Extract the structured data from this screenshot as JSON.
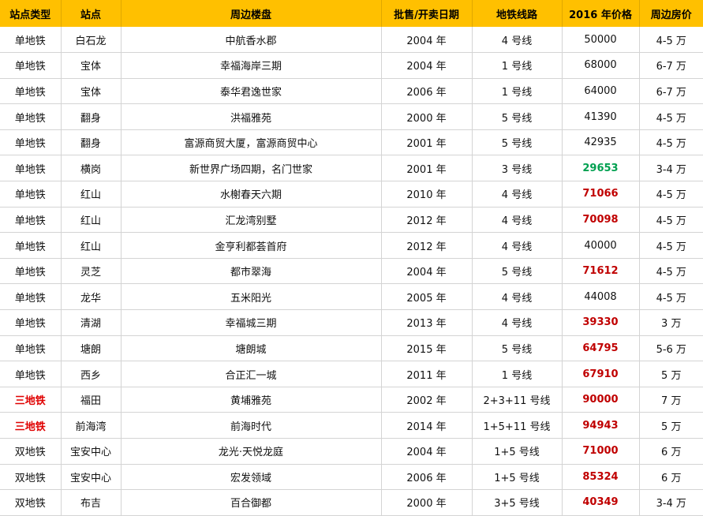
{
  "headers": [
    "站点类型",
    "站点",
    "周边楼盘",
    "批售/开卖日期",
    "地铁线路",
    "2016 年价格",
    "周边房价"
  ],
  "rows": [
    {
      "type": "单地铁",
      "station": "白石龙",
      "estate": "中航香水郡",
      "date": "2004 年",
      "line": "4 号线",
      "price": "50000",
      "nearby": "4-5 万",
      "price_style": "normal",
      "type_style": "normal"
    },
    {
      "type": "单地铁",
      "station": "宝体",
      "estate": "幸福海岸三期",
      "date": "2004 年",
      "line": "1 号线",
      "price": "68000",
      "nearby": "6-7 万",
      "price_style": "normal",
      "type_style": "normal"
    },
    {
      "type": "单地铁",
      "station": "宝体",
      "estate": "泰华君逸世家",
      "date": "2006 年",
      "line": "1 号线",
      "price": "64000",
      "nearby": "6-7 万",
      "price_style": "normal",
      "type_style": "normal"
    },
    {
      "type": "单地铁",
      "station": "翻身",
      "estate": "洪福雅苑",
      "date": "2000 年",
      "line": "5 号线",
      "price": "41390",
      "nearby": "4-5 万",
      "price_style": "normal",
      "type_style": "normal"
    },
    {
      "type": "单地铁",
      "station": "翻身",
      "estate": "富源商贸大厦，富源商贸中心",
      "date": "2001 年",
      "line": "5 号线",
      "price": "42935",
      "nearby": "4-5 万",
      "price_style": "normal",
      "type_style": "normal"
    },
    {
      "type": "单地铁",
      "station": "横岗",
      "estate": "新世界广场四期，名门世家",
      "date": "2001 年",
      "line": "3 号线",
      "price": "29653",
      "nearby": "3-4 万",
      "price_style": "green",
      "type_style": "normal"
    },
    {
      "type": "单地铁",
      "station": "红山",
      "estate": "水榭春天六期",
      "date": "2010 年",
      "line": "4 号线",
      "price": "71066",
      "nearby": "4-5 万",
      "price_style": "red",
      "type_style": "normal"
    },
    {
      "type": "单地铁",
      "station": "红山",
      "estate": "汇龙湾别墅",
      "date": "2012 年",
      "line": "4 号线",
      "price": "70098",
      "nearby": "4-5 万",
      "price_style": "red",
      "type_style": "normal"
    },
    {
      "type": "单地铁",
      "station": "红山",
      "estate": "金亨利都荟首府",
      "date": "2012 年",
      "line": "4 号线",
      "price": "40000",
      "nearby": "4-5 万",
      "price_style": "normal",
      "type_style": "normal"
    },
    {
      "type": "单地铁",
      "station": "灵芝",
      "estate": "都市翠海",
      "date": "2004 年",
      "line": "5 号线",
      "price": "71612",
      "nearby": "4-5 万",
      "price_style": "red",
      "type_style": "normal"
    },
    {
      "type": "单地铁",
      "station": "龙华",
      "estate": "五米阳光",
      "date": "2005 年",
      "line": "4 号线",
      "price": "44008",
      "nearby": "4-5 万",
      "price_style": "normal",
      "type_style": "normal"
    },
    {
      "type": "单地铁",
      "station": "清湖",
      "estate": "幸福城三期",
      "date": "2013 年",
      "line": "4 号线",
      "price": "39330",
      "nearby": "3 万",
      "price_style": "red",
      "type_style": "normal"
    },
    {
      "type": "单地铁",
      "station": "塘朗",
      "estate": "塘朗城",
      "date": "2015 年",
      "line": "5 号线",
      "price": "64795",
      "nearby": "5-6 万",
      "price_style": "red",
      "type_style": "normal"
    },
    {
      "type": "单地铁",
      "station": "西乡",
      "estate": "合正汇一城",
      "date": "2011 年",
      "line": "1 号线",
      "price": "67910",
      "nearby": "5 万",
      "price_style": "red",
      "type_style": "normal"
    },
    {
      "type": "三地铁",
      "station": "福田",
      "estate": "黄埔雅苑",
      "date": "2002 年",
      "line": "2+3+11 号线",
      "price": "90000",
      "nearby": "7 万",
      "price_style": "red",
      "type_style": "red"
    },
    {
      "type": "三地铁",
      "station": "前海湾",
      "estate": "前海时代",
      "date": "2014 年",
      "line": "1+5+11 号线",
      "price": "94943",
      "nearby": "5 万",
      "price_style": "red",
      "type_style": "red"
    },
    {
      "type": "双地铁",
      "station": "宝安中心",
      "estate": "龙光·天悦龙庭",
      "date": "2004 年",
      "line": "1+5 号线",
      "price": "71000",
      "nearby": "6 万",
      "price_style": "red",
      "type_style": "normal"
    },
    {
      "type": "双地铁",
      "station": "宝安中心",
      "estate": "宏发领域",
      "date": "2006 年",
      "line": "1+5 号线",
      "price": "85324",
      "nearby": "6 万",
      "price_style": "red",
      "type_style": "normal"
    },
    {
      "type": "双地铁",
      "station": "布吉",
      "estate": "百合御都",
      "date": "2000 年",
      "line": "3+5 号线",
      "price": "40349",
      "nearby": "3-4 万",
      "price_style": "red",
      "type_style": "normal"
    }
  ],
  "colors": {
    "header_bg": "#ffc000",
    "price_red": "#c00000",
    "price_green": "#00a050",
    "type_red": "#e00000"
  }
}
